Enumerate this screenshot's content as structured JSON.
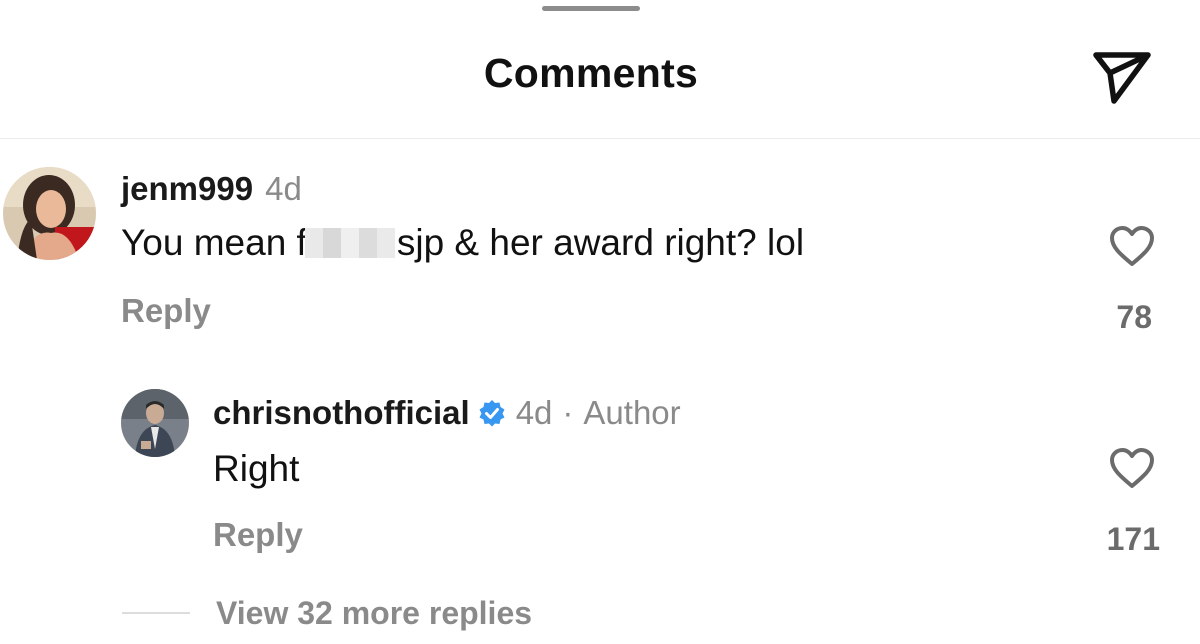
{
  "header": {
    "title": "Comments",
    "share_icon": "send-icon"
  },
  "comments": [
    {
      "username": "jenm999",
      "time": "4d",
      "text_before": "You mean f",
      "text_after": "sjp & her award right? lol",
      "reply_label": "Reply",
      "likes": "78",
      "like_icon": "heart-outline-icon"
    }
  ],
  "replies": [
    {
      "username": "chrisnothofficial",
      "verified_icon": "verified-badge-icon",
      "time": "4d",
      "separator": "·",
      "role": "Author",
      "text": "Right",
      "reply_label": "Reply",
      "likes": "171",
      "like_icon": "heart-outline-icon"
    }
  ],
  "view_more_replies": "View 32 more replies",
  "colors": {
    "verified": "#3897f0",
    "muted_text": "#8a8a8a",
    "primary_text": "#111111"
  }
}
